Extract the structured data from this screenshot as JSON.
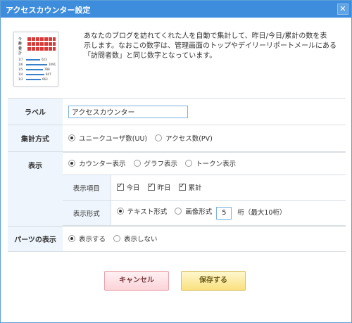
{
  "window": {
    "title": "アクセスカウンター設定",
    "close_label": "✕"
  },
  "thumbnail": {
    "labels": [
      "今日",
      "昨日",
      "累計"
    ],
    "rows": [
      {
        "date": "1/7",
        "value": "623"
      },
      {
        "date": "1/6",
        "value": "1091"
      },
      {
        "date": "1/5",
        "value": "788"
      },
      {
        "date": "1/4",
        "value": "847"
      },
      {
        "date": "1/3",
        "value": "663"
      }
    ]
  },
  "intro": {
    "line1": "あなたのブログを訪れてくれた人を自動で集計して、昨日/今日/累計の数を表",
    "line2": "示します。なおこの数字は、管理画面のトップやデイリーリポートメールにある",
    "line3": "「訪問者数」と同じ数字となっています。"
  },
  "form": {
    "label": {
      "heading": "ラベル",
      "value": "アクセスカウンター"
    },
    "method": {
      "heading": "集計方式",
      "options": [
        {
          "label": "ユニークユーザ数(UU)",
          "selected": true
        },
        {
          "label": "アクセス数(PV)",
          "selected": false
        }
      ]
    },
    "display": {
      "heading": "表示",
      "options": [
        {
          "label": "カウンター表示",
          "selected": true
        },
        {
          "label": "グラフ表示",
          "selected": false
        },
        {
          "label": "トークン表示",
          "selected": false
        }
      ],
      "items": {
        "heading": "表示項目",
        "checks": [
          {
            "label": "今日",
            "checked": true
          },
          {
            "label": "昨日",
            "checked": true
          },
          {
            "label": "累計",
            "checked": true
          }
        ]
      },
      "format": {
        "heading": "表示形式",
        "text_label": "テキスト形式",
        "image_label": "画像形式",
        "digits": "5",
        "digits_suffix": "桁（最大10桁）"
      }
    },
    "parts": {
      "heading": "パーツの表示",
      "options": [
        {
          "label": "表示する",
          "selected": true
        },
        {
          "label": "表示しない",
          "selected": false
        }
      ]
    }
  },
  "buttons": {
    "cancel": "キャンセル",
    "save": "保存する"
  }
}
